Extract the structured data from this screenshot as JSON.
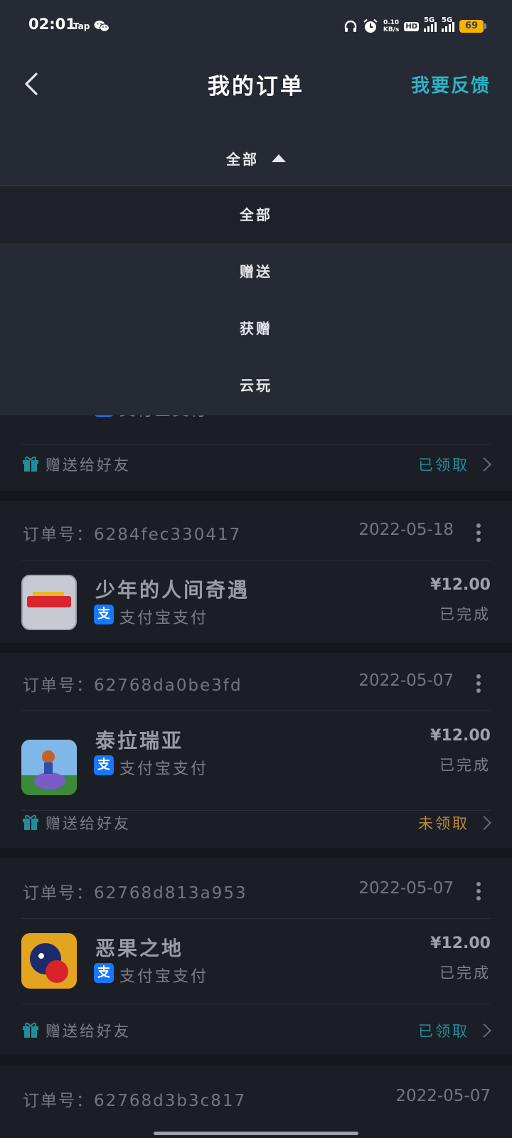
{
  "status_bar": {
    "time": "02:01",
    "app_tag": "Tap",
    "net_speed_value": "0.10",
    "net_speed_unit": "KB/s",
    "hd_label": "HD",
    "sim1_label": "5G",
    "sim2_label": "5G",
    "battery": "69"
  },
  "header": {
    "title": "我的订单",
    "feedback_label": "我要反馈"
  },
  "filter": {
    "selected": "全部",
    "options": [
      "全部",
      "赠送",
      "获赠",
      "云玩"
    ]
  },
  "orders": [
    {
      "pay_method": "支付宝支付",
      "pay_icon": "支",
      "gift_label": "赠送给好友",
      "claim_status": "已领取"
    },
    {
      "order_no": "订单号：6284fec330417",
      "date": "2022-05-18",
      "app_name": "少年的人间奇遇",
      "pay_method": "支付宝支付",
      "pay_icon": "支",
      "price": "¥12.00",
      "status": "已完成"
    },
    {
      "order_no": "订单号：62768da0be3fd",
      "date": "2022-05-07",
      "app_name": "泰拉瑞亚",
      "pay_method": "支付宝支付",
      "pay_icon": "支",
      "price": "¥12.00",
      "status": "已完成",
      "gift_label": "赠送给好友",
      "claim_status": "未领取"
    },
    {
      "order_no": "订单号：62768d813a953",
      "date": "2022-05-07",
      "app_name": "恶果之地",
      "pay_method": "支付宝支付",
      "pay_icon": "支",
      "price": "¥12.00",
      "status": "已完成",
      "gift_label": "赠送给好友",
      "claim_status": "已领取"
    },
    {
      "order_no": "订单号：62768d3b3c817",
      "date": "2022-05-07"
    }
  ],
  "icons": {
    "back": "chevron-left-icon",
    "caret": "caret-up-icon",
    "gift": "gift-icon",
    "more": "more-vertical-icon",
    "chevron": "chevron-right-icon"
  },
  "colors": {
    "background": "#1c1e25",
    "header_background": "#262a35",
    "accent": "#2bb3c4",
    "claimed": "#1f8e9b",
    "unclaimed": "#b98a3e",
    "alipay": "#1677ff"
  }
}
